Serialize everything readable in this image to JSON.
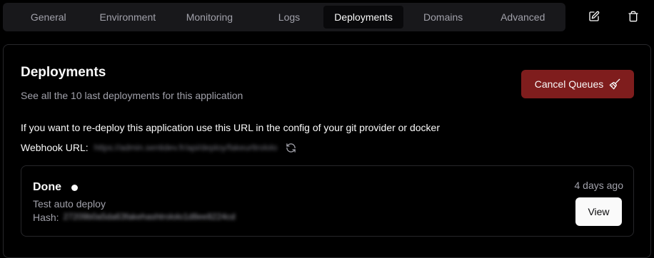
{
  "tabs": [
    {
      "label": "General",
      "active": false
    },
    {
      "label": "Environment",
      "active": false
    },
    {
      "label": "Monitoring",
      "active": false
    },
    {
      "label": "Logs",
      "active": false
    },
    {
      "label": "Deployments",
      "active": true
    },
    {
      "label": "Domains",
      "active": false
    },
    {
      "label": "Advanced",
      "active": false
    }
  ],
  "toolbar": {
    "edit_icon": "pencil-square-icon",
    "delete_icon": "trash-icon"
  },
  "section": {
    "title": "Deployments",
    "subtitle": "See all the 10 last deployments for this application",
    "cancel_button": "Cancel Queues",
    "cancel_icon": "broom-icon",
    "info": "If you want to re-deploy this application use this URL in the config of your git provider or docker",
    "webhook_label": "Webhook URL:",
    "webhook_url": "https://admin.sentidev.fr/api/deploy/fakeurltrololo",
    "refresh_icon": "refresh-icon"
  },
  "deployment": {
    "status": "Done",
    "title": "Test auto deploy",
    "hash_label": "Hash:",
    "hash": "27209b0a5da63fakehashtrololo1d8ee8224cd",
    "time": "4 days ago",
    "view_button": "View"
  },
  "colors": {
    "background": "#000000",
    "tab_bar": "#18181b",
    "active_tab": "#09090b",
    "cancel_button": "#7f1d1d",
    "view_button": "#fafafa",
    "border": "#27272a",
    "muted_text": "#a1a1aa"
  }
}
